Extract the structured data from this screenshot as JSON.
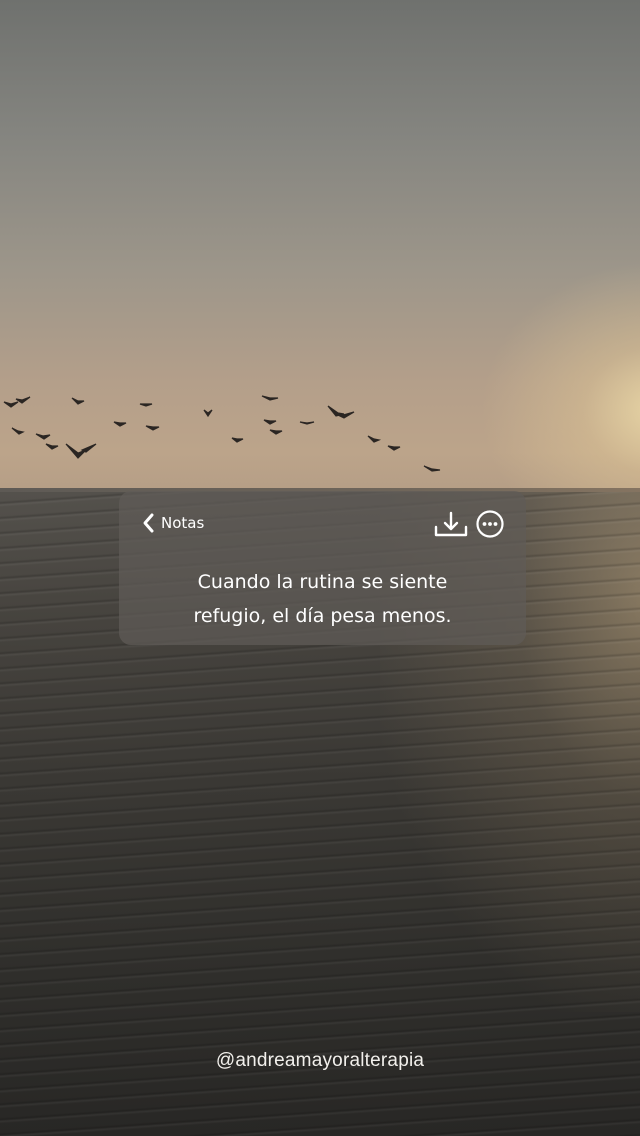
{
  "note_header": {
    "back_label": "Notas",
    "back_icon": "chevron-left-icon",
    "download_icon": "download-icon",
    "more_icon": "more-options-icon"
  },
  "note": {
    "lines": [
      "Cuando la rutina se siente",
      "refugio, el día pesa menos."
    ]
  },
  "footer": {
    "handle": "@andreamayoralterapia"
  },
  "colors": {
    "card_background": "#5f5c58",
    "text": "#ffffff",
    "sky_top": "#6f716e",
    "sky_horizon": "#bca48a",
    "sea": "#3a3834"
  }
}
